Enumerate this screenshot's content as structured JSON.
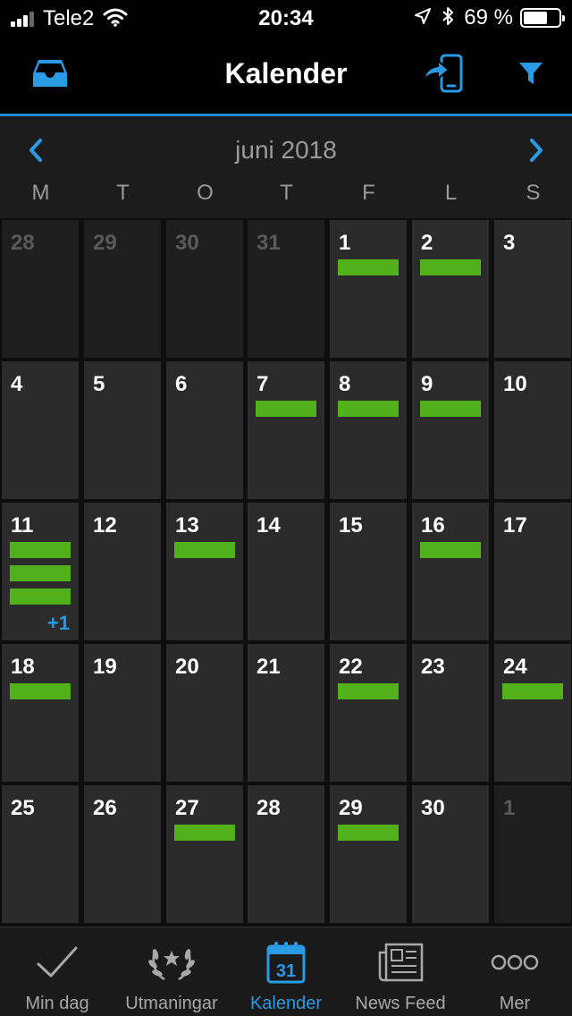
{
  "status_bar": {
    "carrier": "Tele2",
    "time": "20:34",
    "battery_text": "69 %",
    "battery_level": 0.69,
    "icons": [
      "cellular-signal-icon",
      "wifi-icon",
      "location-arrow-icon",
      "bluetooth-icon",
      "battery-icon"
    ]
  },
  "nav": {
    "title": "Kalender",
    "left_icon": "inbox-tray-icon",
    "right_icons": [
      "send-to-device-icon",
      "filter-icon"
    ]
  },
  "colors": {
    "accent": "#2a9ae4",
    "event": "#52b01a",
    "cell": "#2b2b2b",
    "cell_other_month": "#1e1e1e",
    "background": "#000000"
  },
  "calendar": {
    "month_label": "juni 2018",
    "weekdays": [
      "M",
      "T",
      "O",
      "T",
      "F",
      "L",
      "S"
    ],
    "weeks": [
      [
        {
          "day": "28",
          "other_month": true,
          "events": 0
        },
        {
          "day": "29",
          "other_month": true,
          "events": 0
        },
        {
          "day": "30",
          "other_month": true,
          "events": 0
        },
        {
          "day": "31",
          "other_month": true,
          "events": 0
        },
        {
          "day": "1",
          "other_month": false,
          "events": 1
        },
        {
          "day": "2",
          "other_month": false,
          "events": 1
        },
        {
          "day": "3",
          "other_month": false,
          "events": 0
        }
      ],
      [
        {
          "day": "4",
          "other_month": false,
          "events": 0
        },
        {
          "day": "5",
          "other_month": false,
          "events": 0
        },
        {
          "day": "6",
          "other_month": false,
          "events": 0
        },
        {
          "day": "7",
          "other_month": false,
          "events": 1
        },
        {
          "day": "8",
          "other_month": false,
          "events": 1
        },
        {
          "day": "9",
          "other_month": false,
          "events": 1
        },
        {
          "day": "10",
          "other_month": false,
          "events": 0
        }
      ],
      [
        {
          "day": "11",
          "other_month": false,
          "events": 3,
          "more": "+1"
        },
        {
          "day": "12",
          "other_month": false,
          "events": 0
        },
        {
          "day": "13",
          "other_month": false,
          "events": 1
        },
        {
          "day": "14",
          "other_month": false,
          "events": 0
        },
        {
          "day": "15",
          "other_month": false,
          "events": 0
        },
        {
          "day": "16",
          "other_month": false,
          "events": 1
        },
        {
          "day": "17",
          "other_month": false,
          "events": 0
        }
      ],
      [
        {
          "day": "18",
          "other_month": false,
          "events": 1
        },
        {
          "day": "19",
          "other_month": false,
          "events": 0
        },
        {
          "day": "20",
          "other_month": false,
          "events": 0
        },
        {
          "day": "21",
          "other_month": false,
          "events": 0
        },
        {
          "day": "22",
          "other_month": false,
          "events": 1
        },
        {
          "day": "23",
          "other_month": false,
          "events": 0
        },
        {
          "day": "24",
          "other_month": false,
          "events": 1
        }
      ],
      [
        {
          "day": "25",
          "other_month": false,
          "events": 0
        },
        {
          "day": "26",
          "other_month": false,
          "events": 0
        },
        {
          "day": "27",
          "other_month": false,
          "events": 1
        },
        {
          "day": "28",
          "other_month": false,
          "events": 0
        },
        {
          "day": "29",
          "other_month": false,
          "events": 1
        },
        {
          "day": "30",
          "other_month": false,
          "events": 0
        },
        {
          "day": "1",
          "other_month": true,
          "events": 0
        }
      ]
    ]
  },
  "tab_bar": {
    "tabs": [
      {
        "label": "Min dag",
        "icon": "checkmark-icon",
        "active": false
      },
      {
        "label": "Utmaningar",
        "icon": "laurel-wreath-icon",
        "active": false
      },
      {
        "label": "Kalender",
        "icon": "calendar-icon",
        "icon_text": "31",
        "active": true
      },
      {
        "label": "News Feed",
        "icon": "newspaper-icon",
        "active": false
      },
      {
        "label": "Mer",
        "icon": "more-dots-icon",
        "active": false
      }
    ]
  }
}
